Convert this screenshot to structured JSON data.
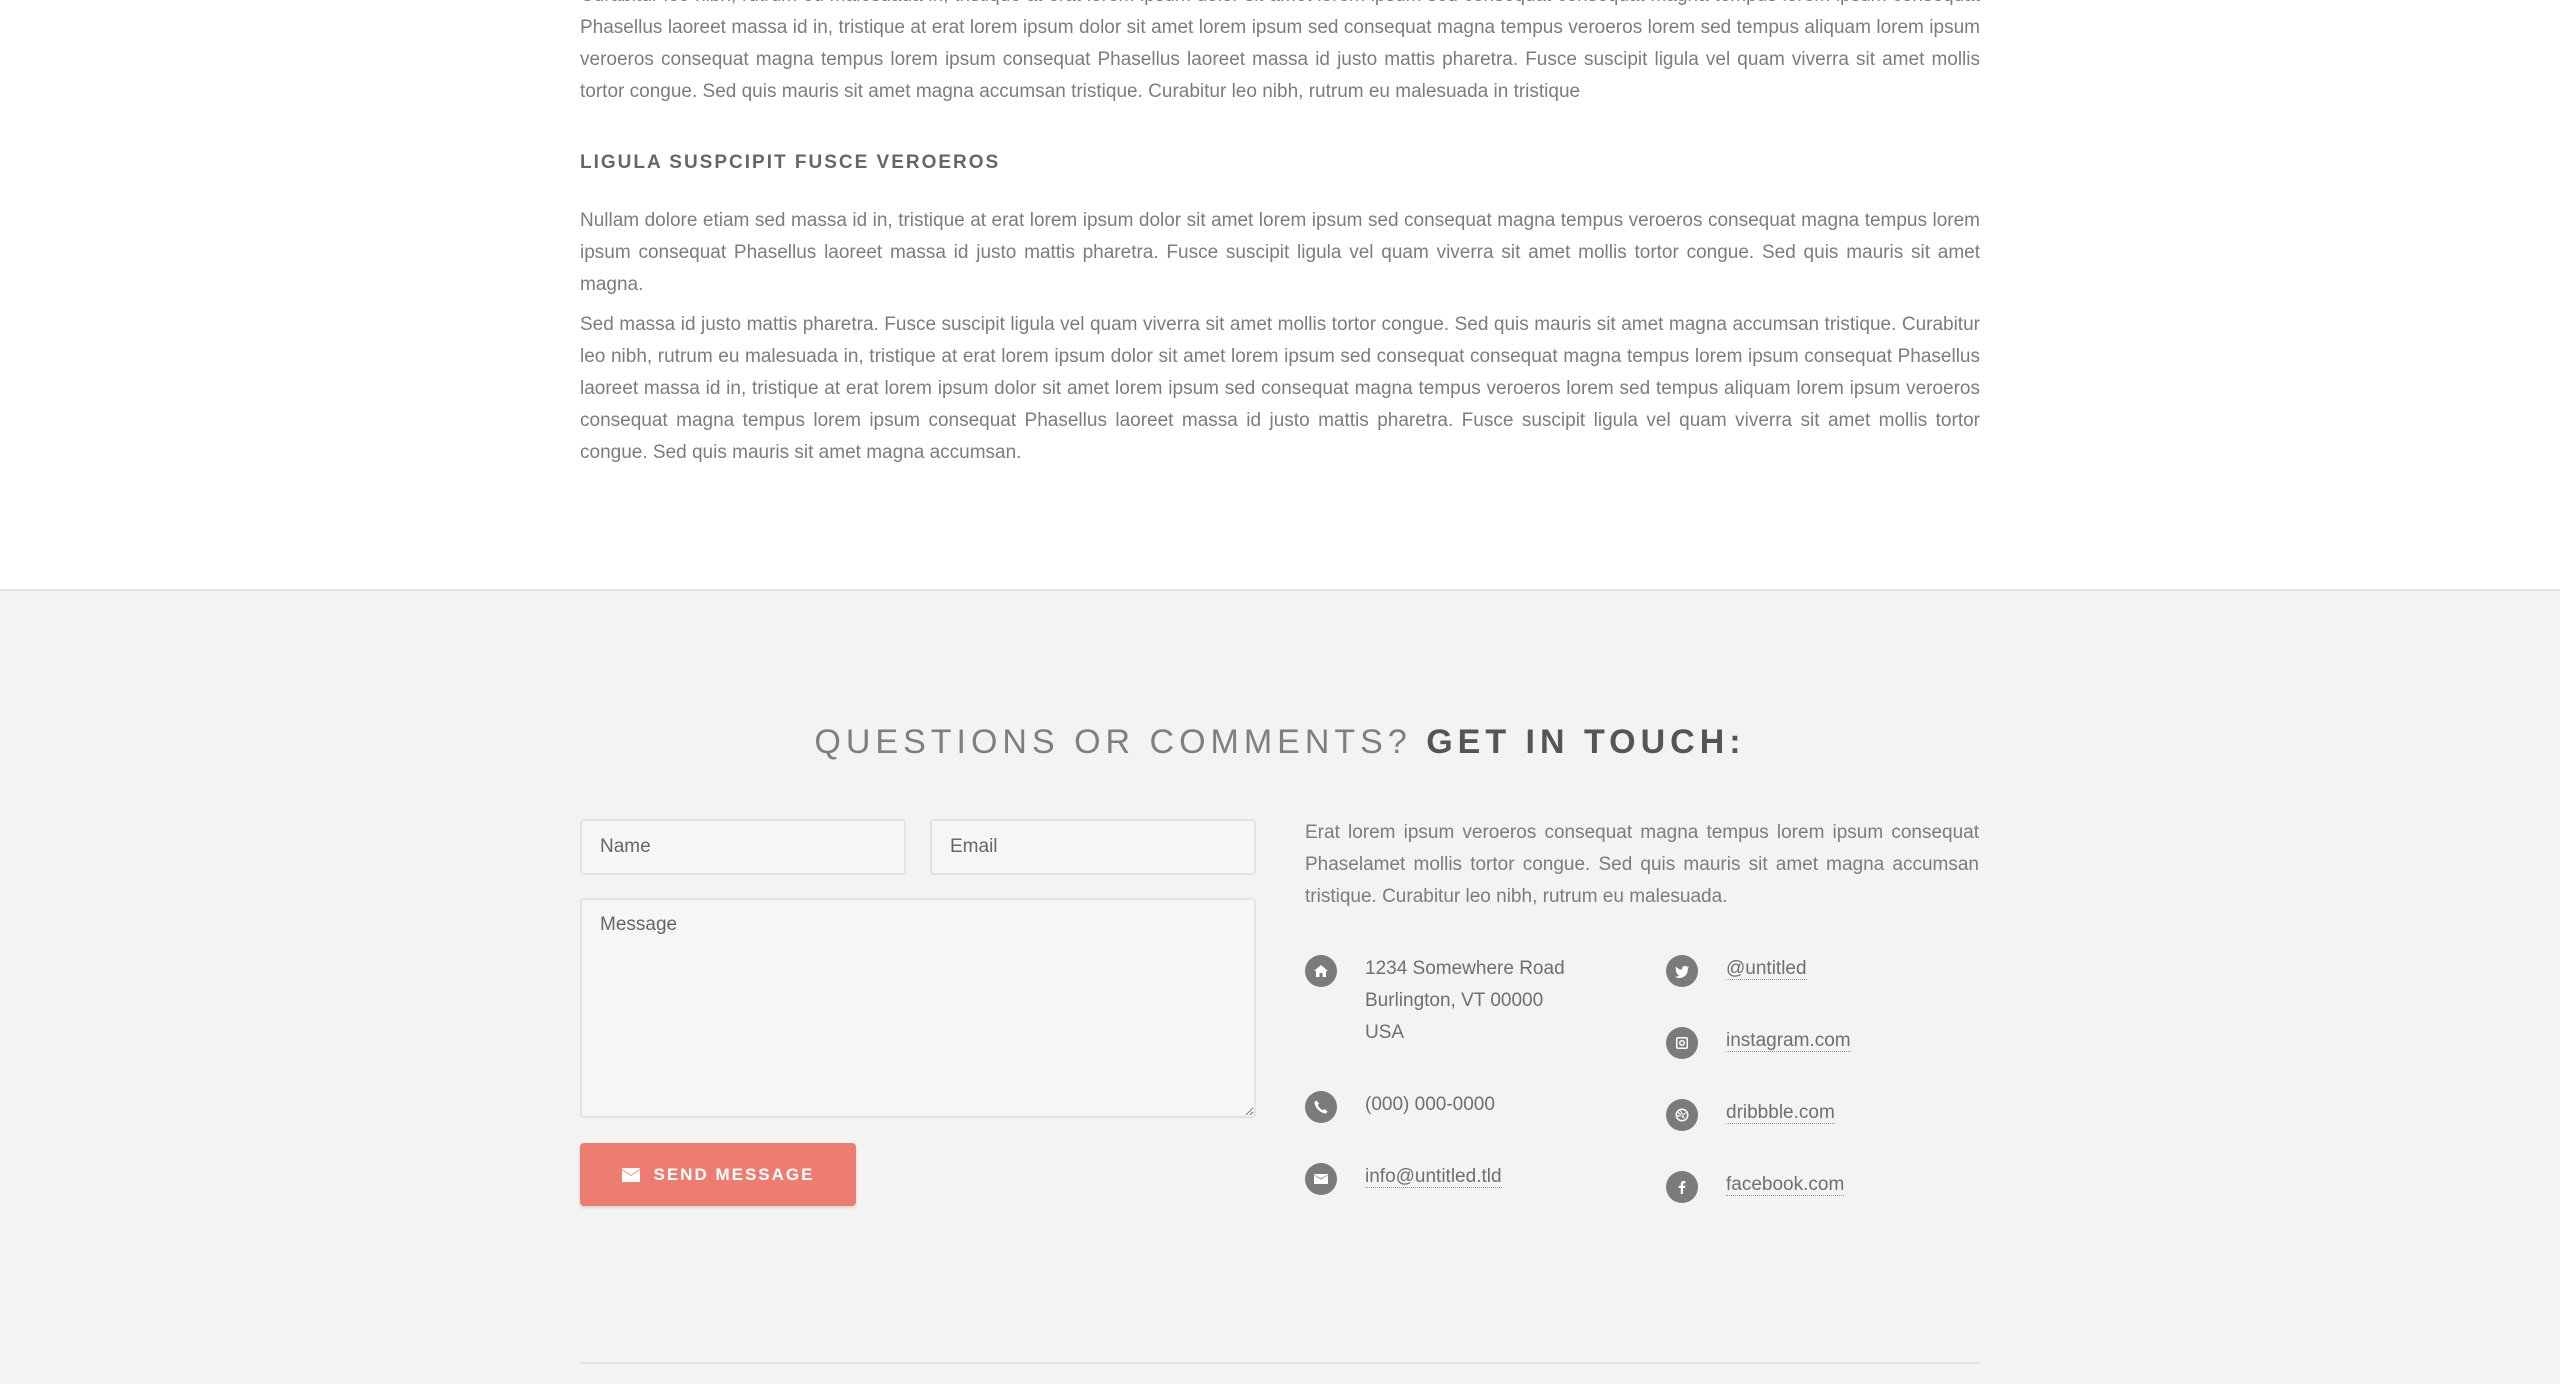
{
  "article": {
    "paragraph1": "Curabitur leo nibh, rutrum eu malesuada in, tristique at erat lorem ipsum dolor sit amet lorem ipsum sed consequat consequat magna tempus lorem ipsum consequat Phasellus laoreet massa id in, tristique at erat lorem ipsum dolor sit amet lorem ipsum sed consequat magna tempus veroeros lorem sed tempus aliquam lorem ipsum veroeros consequat magna tempus lorem ipsum consequat Phasellus laoreet massa id justo mattis pharetra. Fusce suscipit ligula vel quam viverra sit amet mollis tortor congue. Sed quis mauris sit amet magna accumsan tristique. Curabitur leo nibh, rutrum eu malesuada in tristique",
    "heading": "LIGULA SUSPCIPIT FUSCE VEROEROS",
    "paragraph2": "Nullam dolore etiam sed massa id in, tristique at erat lorem ipsum dolor sit amet lorem ipsum sed consequat magna tempus veroeros consequat magna tempus lorem ipsum consequat Phasellus laoreet massa id justo mattis pharetra. Fusce suscipit ligula vel quam viverra sit amet mollis tortor congue. Sed quis mauris sit amet magna.",
    "paragraph3": "Sed massa id justo mattis pharetra. Fusce suscipit ligula vel quam viverra sit amet mollis tortor congue. Sed quis mauris sit amet magna accumsan tristique. Curabitur leo nibh, rutrum eu malesuada in, tristique at erat lorem ipsum dolor sit amet lorem ipsum sed consequat consequat magna tempus lorem ipsum consequat Phasellus laoreet massa id in, tristique at erat lorem ipsum dolor sit amet lorem ipsum sed consequat magna tempus veroeros lorem sed tempus aliquam lorem ipsum veroeros consequat magna tempus lorem ipsum consequat Phasellus laoreet massa id justo mattis pharetra. Fusce suscipit ligula vel quam viverra sit amet mollis tortor congue. Sed quis mauris sit amet magna accumsan."
  },
  "contact": {
    "title_light": "QUESTIONS OR COMMENTS?",
    "title_bold": "GET IN TOUCH:",
    "form": {
      "name_placeholder": "Name",
      "email_placeholder": "Email",
      "message_placeholder": "Message",
      "send_label": "SEND MESSAGE",
      "send_icon": "envelope-icon"
    },
    "blurb": "Erat lorem ipsum veroeros consequat magna tempus lorem ipsum consequat Phaselamet mollis tortor congue. Sed quis mauris sit amet magna accumsan tristique. Curabitur leo nibh, rutrum eu malesuada.",
    "address": {
      "line1": "1234 Somewhere Road",
      "line2": "Burlington, VT 00000",
      "line3": "USA",
      "icon": "home-icon"
    },
    "phone": {
      "value": "(000) 000-0000",
      "icon": "phone-icon"
    },
    "email": {
      "value": "info@untitled.tld",
      "icon": "envelope-icon"
    },
    "twitter": {
      "value": "@untitled",
      "icon": "twitter-icon"
    },
    "instagram": {
      "value": "instagram.com",
      "icon": "instagram-icon"
    },
    "dribbble": {
      "value": "dribbble.com",
      "icon": "dribbble-icon"
    },
    "facebook": {
      "value": "facebook.com",
      "icon": "facebook-icon"
    }
  },
  "colors": {
    "accent": "#ee7d71",
    "section_bg": "#f3f3f3",
    "icon_bg": "#7b7b7b"
  }
}
